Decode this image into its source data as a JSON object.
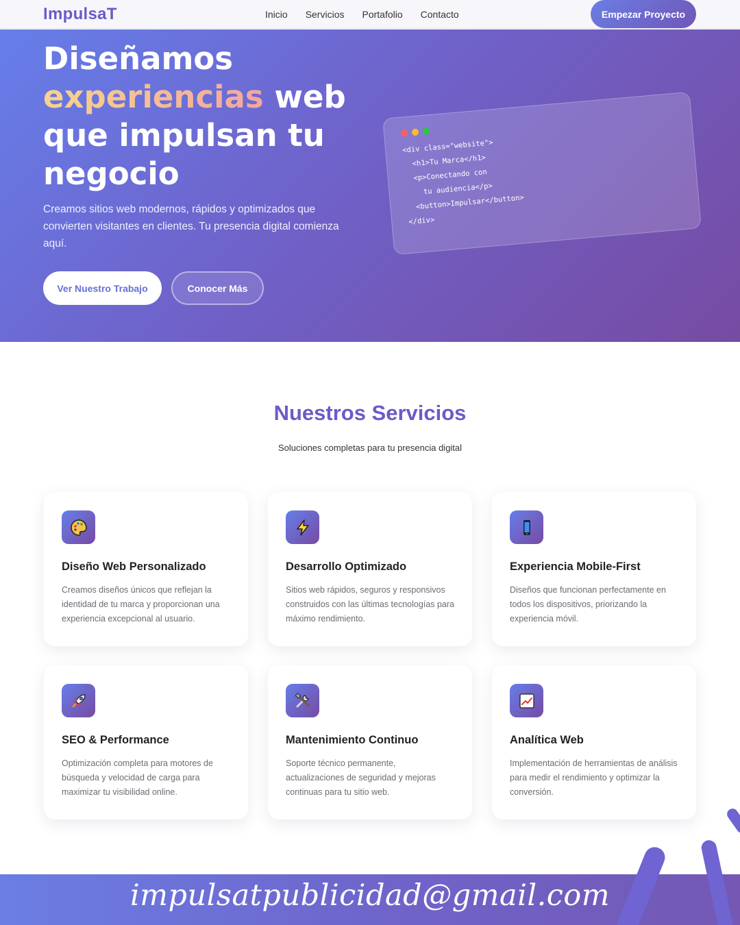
{
  "nav": {
    "logo": "ImpulsaT",
    "links": [
      "Inicio",
      "Servicios",
      "Portafolio",
      "Contacto"
    ],
    "cta": "Empezar Proyecto"
  },
  "hero": {
    "title_line1": "Diseñamos",
    "title_highlight": "experiencias",
    "title_line2_rest": " web",
    "title_line3": "que impulsan tu",
    "title_line4": "negocio",
    "subtitle": "Creamos sitios web modernos, rápidos y optimizados que convierten visitantes en clientes. Tu presencia digital comienza aquí.",
    "primary_button": "Ver Nuestro Trabajo",
    "secondary_button": "Conocer Más",
    "code_lines": [
      "<div class=\"website\">",
      "  <h1>Tu Marca</h1>",
      "  <p>Conectando con",
      "    tu audiencia</p>",
      "  <button>Impulsar</button>",
      "</div>"
    ],
    "window_dot_colors": [
      "#ff5f57",
      "#febc2e",
      "#28c840"
    ]
  },
  "services": {
    "title": "Nuestros Servicios",
    "subtitle": "Soluciones completas para tu presencia digital",
    "items": [
      {
        "icon": "palette-icon",
        "title": "Diseño Web Personalizado",
        "text": "Creamos diseños únicos que reflejan la identidad de tu marca y proporcionan una experiencia excepcional al usuario."
      },
      {
        "icon": "lightning-icon",
        "title": "Desarrollo Optimizado",
        "text": "Sitios web rápidos, seguros y responsivos construidos con las últimas tecnologías para máximo rendimiento."
      },
      {
        "icon": "mobile-phone-icon",
        "title": "Experiencia Mobile-First",
        "text": "Diseños que funcionan perfectamente en todos los dispositivos, priorizando la experiencia móvil."
      },
      {
        "icon": "rocket-icon",
        "title": "SEO & Performance",
        "text": "Optimización completa para motores de búsqueda y velocidad de carga para maximizar tu visibilidad online."
      },
      {
        "icon": "tools-icon",
        "title": "Mantenimiento Continuo",
        "text": "Soporte técnico permanente, actualizaciones de seguridad y mejoras continuas para tu sitio web."
      },
      {
        "icon": "chart-icon",
        "title": "Analítica Web",
        "text": "Implementación de herramientas de análisis para medir el rendimiento y optimizar la conversión."
      }
    ]
  },
  "footer": {
    "email": "impulsatpublicidad@gmail.com"
  },
  "colors": {
    "brand": "#6b5bc7",
    "gradient_start": "#667eea",
    "gradient_end": "#764ba2"
  }
}
